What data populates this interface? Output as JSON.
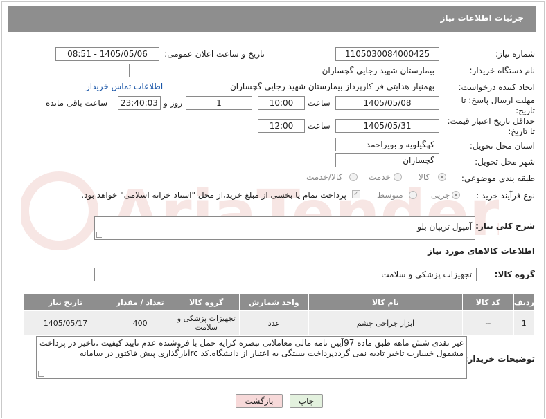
{
  "header": {
    "title": "جزئیات اطلاعات نیاز"
  },
  "fields": {
    "need_number_label": "شماره نیاز:",
    "need_number": "1105030084000425",
    "announce_label": "تاریخ و ساعت اعلان عمومی:",
    "announce_value": "1405/05/06 - 08:51",
    "buyer_label": "نام دستگاه خریدار:",
    "buyer_value": "بیمارستان شهید رجایی گچساران",
    "creator_label": "ایجاد کننده درخواست:",
    "creator_value": "بهمنیار هدایتی فر کارپرداز بیمارستان شهید رجایی گچساران",
    "contact_link": "اطلاعات تماس خریدار",
    "deadline_label": "مهلت ارسال پاسخ: تا تاریخ:",
    "deadline_date": "1405/05/08",
    "time_label": "ساعت",
    "deadline_time": "10:00",
    "days_value": "1",
    "days_label": "روز و",
    "remaining_value": "23:40:03",
    "remaining_label": "ساعت باقی مانده",
    "min_price_label": "حداقل تاریخ اعتبار قیمت: تا تاریخ:",
    "min_price_date": "1405/05/31",
    "time_label2": "ساعت",
    "min_price_time": "12:00",
    "province_label": "استان محل تحویل:",
    "province_value": "کهگیلویه و بویراحمد",
    "city_label": "شهر محل تحویل:",
    "city_value": "گچساران",
    "category_label": "طبقه بندی موضوعی:",
    "category_options": [
      "کالا",
      "خدمت",
      "کالا/خدمت"
    ],
    "process_label": "نوع فرآیند خرید :",
    "process_options": [
      "جزیی",
      "متوسط"
    ],
    "payment_note": "پرداخت تمام یا بخشی از مبلغ خرید،از محل \"اسناد خزانه اسلامی\" خواهد بود."
  },
  "description": {
    "label": "شرح کلی نیاز:",
    "value": "آمپول تریپان بلو"
  },
  "goods": {
    "section_title": "اطلاعات کالاهای مورد نیاز",
    "group_label": "گروه کالا:",
    "group_value": "تجهیزات پزشکی و سلامت",
    "columns": [
      "ردیف",
      "کد کالا",
      "نام کالا",
      "واحد شمارش",
      "گروه کالا",
      "تعداد / مقدار",
      "تاریخ نیاز"
    ],
    "rows": [
      {
        "row": "1",
        "code": "--",
        "name": "ابزار جراحی چشم",
        "unit": "عدد",
        "group": "تجهیزات پزشکی و سلامت",
        "qty": "400",
        "date": "1405/05/17"
      }
    ]
  },
  "buyer_notes": {
    "label": "توضیحات خریدار:",
    "line1": "غیر نقدی شش ماهه طبق ماده 97آیین نامه مالی معاملاتی تبصره کرایه حمل با فروشنده عدم تایید کیفیت ،تاخیر در پرداخت",
    "line2": "مشمول خسارت تاخیر تادیه نمی گرددپرداخت بستگی به اعتبار از دانشگاه.کد ircبارگذاری پیش فاکتور در سامانه"
  },
  "buttons": {
    "print": "چاپ",
    "back": "بازگشت"
  },
  "watermark": "AriaTender.net",
  "colors": {
    "header": "#8e8e8e",
    "link": "#1a56a8",
    "back_bg": "#f7d9d9",
    "print_bg": "#e3f1de",
    "watermark": "#c0392b"
  }
}
